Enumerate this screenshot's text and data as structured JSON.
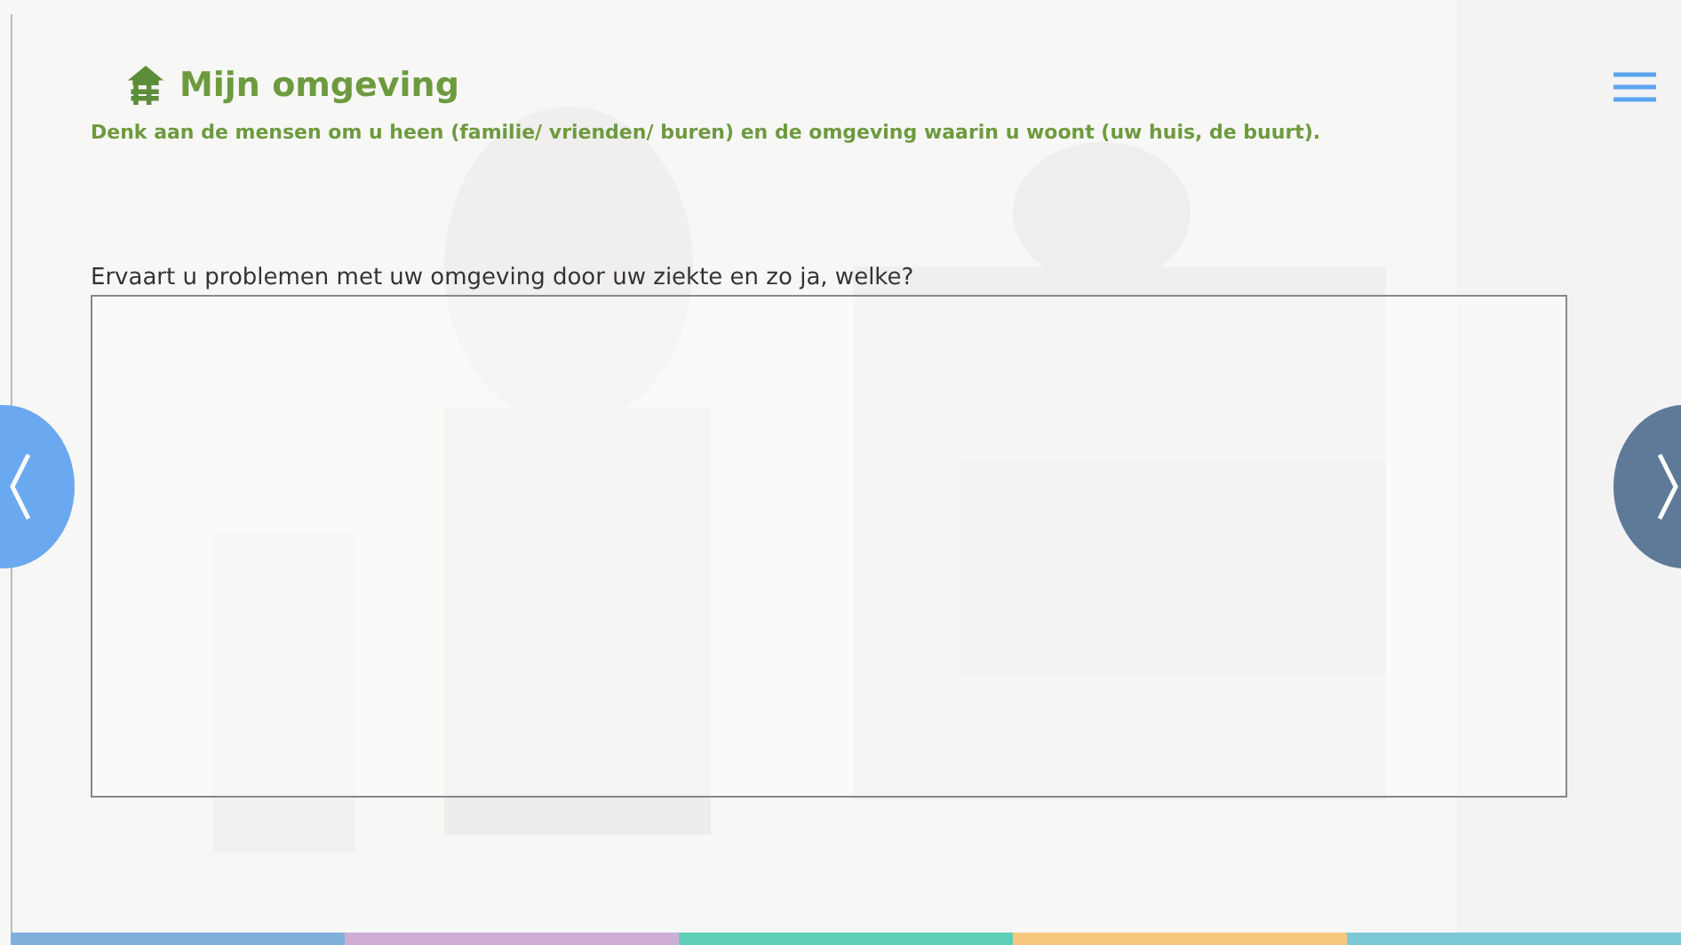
{
  "header": {
    "title": "Mijn omgeving",
    "subtitle": "Denk aan de mensen om u heen (familie/ vrienden/ buren) en de omgeving waarin u woont (uw huis, de buurt)."
  },
  "question": {
    "label": "Ervaart u problemen met uw omgeving door uw ziekte en zo ja, welke?"
  },
  "stripes": [
    {
      "color": "#7fb0dc"
    },
    {
      "color": "#cfaed6"
    },
    {
      "color": "#5fd0b8"
    },
    {
      "color": "#f8c77f"
    },
    {
      "color": "#7cc9d8"
    }
  ]
}
